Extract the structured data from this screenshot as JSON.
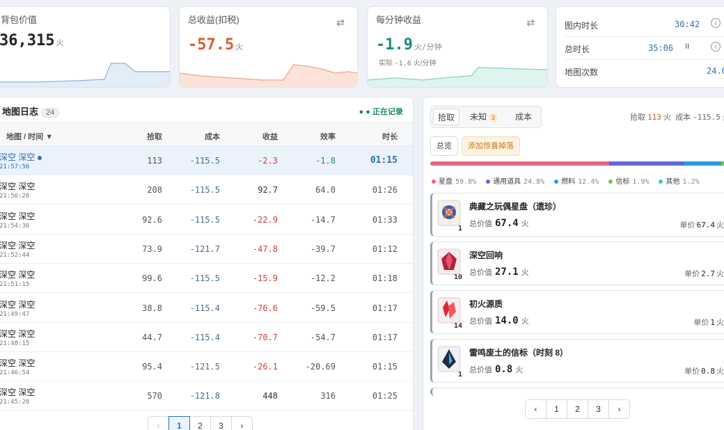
{
  "stats": {
    "bag_value": {
      "title": "背包价值",
      "value": "36,315",
      "unit": "火"
    },
    "total_profit": {
      "title": "总收益(扣税)",
      "value": "-57.5",
      "unit": "火",
      "swap_icon": "swap-icon"
    },
    "per_minute": {
      "title": "每分钟收益",
      "value": "-1.9",
      "unit": "火/分钟",
      "actual_label": "实际",
      "actual_value": "-1.6",
      "actual_unit": "火/分钟",
      "swap_icon": "swap-icon"
    },
    "timers": {
      "map_time_label": "图内时长",
      "map_time": "30:42",
      "total_time_label": "总时长",
      "total_time": "35:06",
      "pause_glyph": "II",
      "map_count_label": "地图次数",
      "map_count": "24.0"
    }
  },
  "log": {
    "title": "地图日志",
    "count": "24",
    "recording": "● 正在记录",
    "headers": [
      "地图 / 时间 ▼",
      "拾取",
      "成本",
      "收益",
      "效率",
      "时长"
    ],
    "rows": [
      {
        "name": "深空 深空",
        "time": "21:57:56",
        "pickup": "113",
        "cost": "-115.5",
        "profit": "-2.3",
        "eff": "-1.8",
        "dur": "01:15"
      },
      {
        "name": "深空 深空",
        "time": "21:56:20",
        "pickup": "208",
        "cost": "-115.5",
        "profit": "92.7",
        "eff": "64.0",
        "dur": "01:26"
      },
      {
        "name": "深空 深空",
        "time": "21:54:36",
        "pickup": "92.6",
        "cost": "-115.5",
        "profit": "-22.9",
        "eff": "-14.7",
        "dur": "01:33"
      },
      {
        "name": "深空 深空",
        "time": "21:52:44",
        "pickup": "73.9",
        "cost": "-121.7",
        "profit": "-47.8",
        "eff": "-39.7",
        "dur": "01:12"
      },
      {
        "name": "深空 深空",
        "time": "21:51:15",
        "pickup": "99.6",
        "cost": "-115.5",
        "profit": "-15.9",
        "eff": "-12.2",
        "dur": "01:18"
      },
      {
        "name": "深空 深空",
        "time": "21:49:47",
        "pickup": "38.8",
        "cost": "-115.4",
        "profit": "-76.6",
        "eff": "-59.5",
        "dur": "01:17"
      },
      {
        "name": "深空 深空",
        "time": "21:48:15",
        "pickup": "44.7",
        "cost": "-115.4",
        "profit": "-70.7",
        "eff": "-54.7",
        "dur": "01:17"
      },
      {
        "name": "深空 深空",
        "time": "21:46:54",
        "pickup": "95.4",
        "cost": "-121.5",
        "profit": "-26.1",
        "eff": "-20.69",
        "dur": "01:15"
      },
      {
        "name": "深空 深空",
        "time": "21:45:20",
        "pickup": "570",
        "cost": "-121.8",
        "profit": "448",
        "eff": "316",
        "dur": "01:25"
      }
    ],
    "pager": {
      "prev": "‹",
      "pages": [
        "1",
        "2",
        "3"
      ],
      "next": "›",
      "current": "1"
    }
  },
  "detail": {
    "tabs": {
      "pickup": "拾取",
      "unknown": "未知",
      "unknown_count": "3",
      "cost": "成本"
    },
    "summary": {
      "pickup_label": "拾取",
      "pickup_value": "113",
      "pickup_unit": "火",
      "cost_label": "成本",
      "cost_value": "-115.5",
      "cost_unit": "火"
    },
    "subtabs": {
      "overview": "总览",
      "add_drop": "添加惊喜掉落"
    },
    "categories": [
      {
        "name": "星盘",
        "pct": "59.8%",
        "share": 59.8,
        "color": "#e9657d"
      },
      {
        "name": "通用道具",
        "pct": "24.8%",
        "share": 24.8,
        "color": "#6568d8"
      },
      {
        "name": "燃料",
        "pct": "12.4%",
        "share": 12.4,
        "color": "#2a9de0"
      },
      {
        "name": "信标",
        "pct": "1.9%",
        "share": 1.9,
        "color": "#7cc23a"
      },
      {
        "name": "其他",
        "pct": "1.2%",
        "share": 1.2,
        "color": "#3dc9c1"
      }
    ],
    "items": [
      {
        "name": "典藏之玩偶星盘（遗珍）",
        "qty": "1",
        "total_label": "总价值",
        "total": "67.4",
        "unit": "火",
        "price_label": "单价",
        "price": "67.4",
        "icon": "astrolabe-icon"
      },
      {
        "name": "深空回响",
        "qty": "10",
        "total_label": "总价值",
        "total": "27.1",
        "unit": "火",
        "price_label": "单价",
        "price": "2.7",
        "icon": "echo-gem-icon"
      },
      {
        "name": "初火源质",
        "qty": "14",
        "total_label": "总价值",
        "total": "14.0",
        "unit": "火",
        "price_label": "单价",
        "price": "1",
        "icon": "fire-crystal-icon"
      },
      {
        "name": "雷鸣废土的信标（时刻 8）",
        "qty": "1",
        "total_label": "总价值",
        "total": "0.8",
        "unit": "火",
        "price_label": "单价",
        "price": "0.8",
        "icon": "beacon-icon"
      }
    ],
    "pager": {
      "prev": "‹",
      "pages": [
        "1",
        "2",
        "3"
      ],
      "next": "›"
    }
  }
}
